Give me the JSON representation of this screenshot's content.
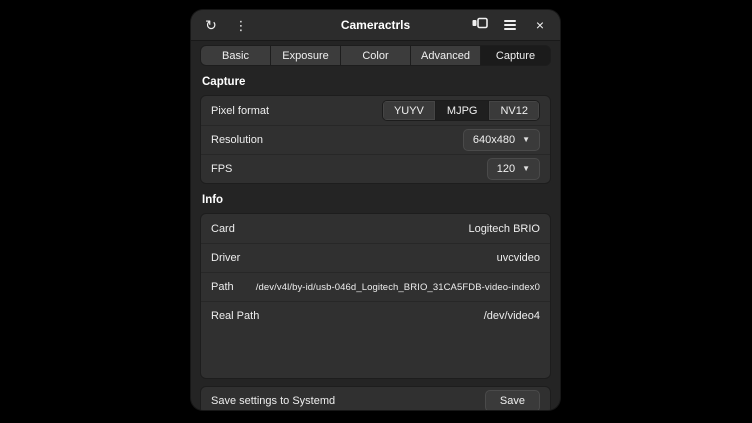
{
  "titlebar": {
    "title": "Cameractrls",
    "refresh_icon_glyph": "↻",
    "kebab_icon_glyph": "⋮",
    "close_icon_glyph": "×"
  },
  "tabs": [
    {
      "label": "Basic",
      "active": false
    },
    {
      "label": "Exposure",
      "active": false
    },
    {
      "label": "Color",
      "active": false
    },
    {
      "label": "Advanced",
      "active": false
    },
    {
      "label": "Capture",
      "active": true
    }
  ],
  "capture_section": {
    "title": "Capture",
    "pixel_format": {
      "label": "Pixel format",
      "options": [
        "YUYV",
        "MJPG",
        "NV12"
      ],
      "selected": "MJPG"
    },
    "resolution": {
      "label": "Resolution",
      "value": "640x480"
    },
    "fps": {
      "label": "FPS",
      "value": "120"
    },
    "dropdown_arrow_glyph": "▼"
  },
  "info_section": {
    "title": "Info",
    "rows": [
      {
        "label": "Card",
        "value": "Logitech BRIO"
      },
      {
        "label": "Driver",
        "value": "uvcvideo"
      },
      {
        "label": "Path",
        "value": "/dev/v4l/by-id/usb-046d_Logitech_BRIO_31CA5FDB-video-index0"
      },
      {
        "label": "Real Path",
        "value": "/dev/video4"
      }
    ]
  },
  "footer": {
    "label": "Save settings to Systemd",
    "button_label": "Save"
  },
  "colors": {
    "window_bg": "#242424",
    "headerbar_bg": "#2c2c2c",
    "card_bg": "#303030",
    "button_bg": "#3a3a3a",
    "selected_bg": "#1f1f1f",
    "text": "#eeeeee"
  }
}
